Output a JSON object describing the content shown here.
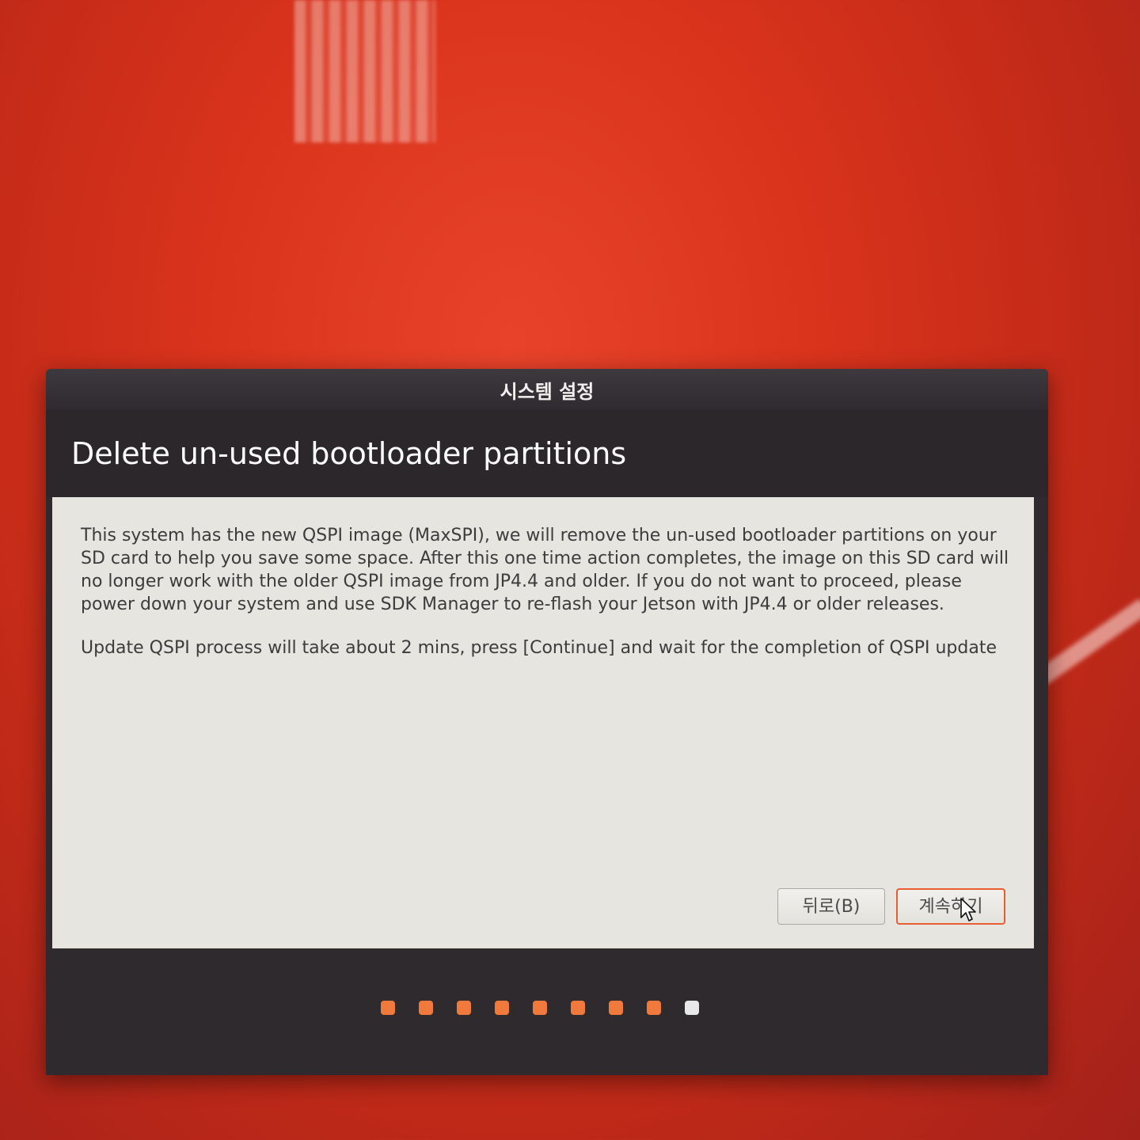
{
  "window": {
    "title": "시스템 설정"
  },
  "page": {
    "heading": "Delete un-used bootloader partitions",
    "paragraphs": [
      "This system has the new QSPI image (MaxSPI), we will remove the un-used bootloader partitions on your SD card to help you save some space. After this one time action completes, the image on this SD card will no longer work with the older QSPI image from JP4.4 and older. If you do not want to proceed, please power down your system and use SDK Manager to re-flash your Jetson with JP4.4 or older releases.",
      "Update QSPI process will take about 2 mins, press [Continue] and wait for the completion of QSPI update"
    ]
  },
  "buttons": {
    "back_label": "뒤로(B)",
    "continue_label": "계속하기"
  },
  "progress": {
    "total_steps": 9,
    "current_step": 9
  },
  "colors": {
    "accent": "#e95d33",
    "dot_done": "#f07a3c",
    "dot_current": "#e8e8e8",
    "dialog_bg": "#2e2a2e",
    "content_bg": "#e6e5e0"
  }
}
